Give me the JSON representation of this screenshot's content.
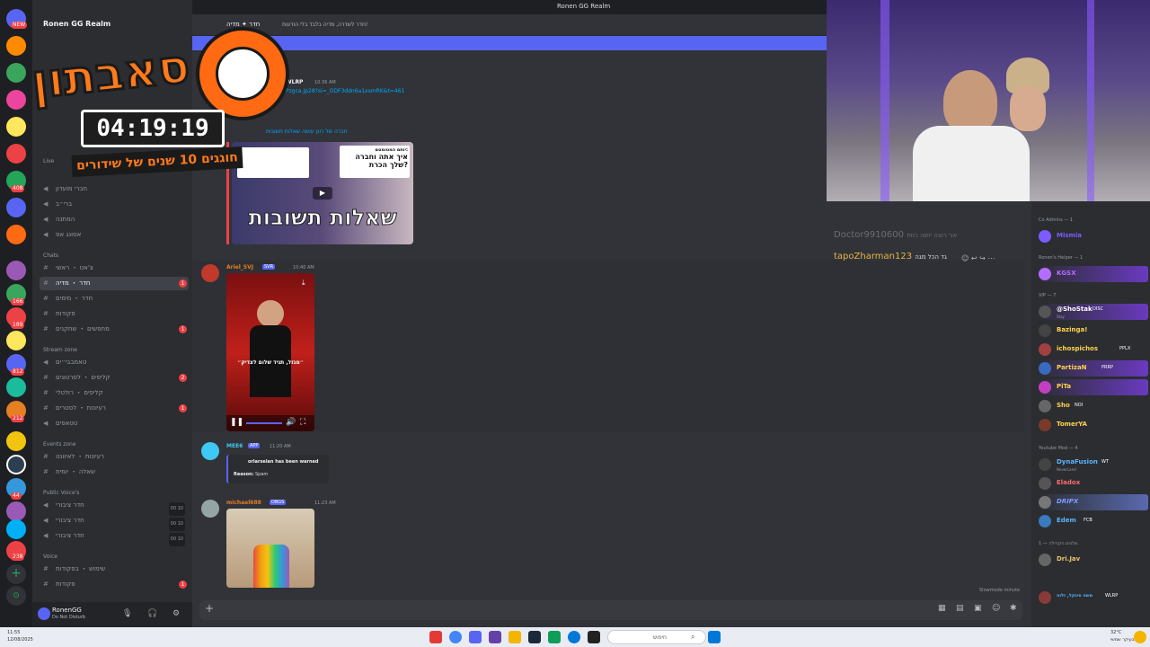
{
  "window": {
    "title": "Ronen GG Realm"
  },
  "server": {
    "name": "Ronen GG Realm",
    "badges": [
      "NEW",
      "101",
      "408",
      "166",
      "189",
      "812",
      "173",
      "212",
      "44",
      "238"
    ]
  },
  "channel_header": {
    "name": "חדר ✦ מדיה",
    "topic": "חדר לשדרה, מדיה בלבד בלי הודעות!"
  },
  "sidebar": {
    "categories": {
      "live": "Live",
      "chats": "Chats",
      "stream": "Stream zone",
      "events": "Events zone",
      "public_voice": "Public Voice's",
      "voice": "Voice"
    },
    "channels": [
      {
        "name": "חברי מועדון",
        "type": "voice"
      },
      {
        "name": "ברי״ב",
        "type": "voice"
      },
      {
        "name": "המתנה",
        "type": "voice"
      },
      {
        "name": "אסונג אס",
        "type": "voice"
      },
      {
        "name": "צ'אט ・ ראשי",
        "type": "text"
      },
      {
        "name": "חדר ・ מדיה",
        "type": "text",
        "active": true,
        "badge": "1"
      },
      {
        "name": "חדר ・ מימים",
        "type": "text"
      },
      {
        "name": "פקודות",
        "type": "text"
      },
      {
        "name": "מחפשים ・ שחקנים",
        "type": "text",
        "badge": "1"
      },
      {
        "name": "טאמבבי״ים",
        "type": "voice"
      },
      {
        "name": "קליפים ・ לסרטונים",
        "type": "text",
        "badge": "2"
      },
      {
        "name": "קליפים ・ רולטלי",
        "type": "text"
      },
      {
        "name": "רעיונות ・ לסטרים",
        "type": "text",
        "badge": "1"
      },
      {
        "name": "טטאפים",
        "type": "voice"
      },
      {
        "name": "רעיונות ・ לאיוונט",
        "type": "text"
      },
      {
        "name": "שאלה ・ יומית",
        "type": "text"
      },
      {
        "name": "חדר ציבורי",
        "type": "voice",
        "users": "00 10"
      },
      {
        "name": "חדר ציבורי",
        "type": "voice",
        "users": "00 10"
      },
      {
        "name": "חדר ציבורי",
        "type": "voice",
        "users": "00 10"
      },
      {
        "name": "שימוש ・ בפקודות",
        "type": "text"
      },
      {
        "name": "פקודות",
        "type": "text",
        "badge": "1"
      }
    ]
  },
  "user_panel": {
    "name": "RonenGG",
    "status": "Do Not Disturb"
  },
  "messages": {
    "first": {
      "author": "WLRP",
      "time": "10:36 AM",
      "link": "Pzgca.Jp28?si=_ODF3ddn6a1xsmRK&t=461",
      "embed_title": "חברה של רונן עושה שאלות תשובות",
      "thumb_text": "שאלות תשובות",
      "thumb_caption_1": "איך אתה וחברה",
      "thumb_caption_2": "שלך הכרת?",
      "thumb_caption_3": "יותם המטומטם:"
    },
    "second": {
      "author": "Ariel_SVJ",
      "tag": "SVR",
      "time": "10:40 AM",
      "video_caption": "״מגזל, תגיד שלום לצדיק״"
    },
    "third": {
      "author": "MEE6",
      "tag": "APP",
      "time": "11:20 AM",
      "warn_line": "orlarselan has been warned",
      "reason_label": "Reason:",
      "reason_value": "Spam"
    },
    "fourth": {
      "author": "michael688",
      "tag": "DBGS",
      "time": "11:23 AM"
    }
  },
  "composer": {
    "placeholder": ""
  },
  "slowmode": "Slowmode minute",
  "stream_chat": [
    {
      "user": "Doctor9910600",
      "text": "אני רוצה יושה כזות"
    },
    {
      "user": "tapoZharman123",
      "text": "גד הכל מגה"
    }
  ],
  "member_list": {
    "groups": [
      {
        "label": "Co Admins — 1",
        "members": [
          {
            "name": "Mismia",
            "color": "#7c5bff"
          }
        ]
      },
      {
        "label": "Ronen's Helper — 1",
        "members": [
          {
            "name": "KGSX",
            "color": "#b56dff"
          }
        ]
      },
      {
        "label": "VIP — 7",
        "members": [
          {
            "name": "@ShoStak",
            "color": "#ffffff",
            "tag": "DISC",
            "sub": "Stay"
          },
          {
            "name": "Bazinga!",
            "color": "#ffd34a"
          },
          {
            "name": "ichospichos",
            "color": "#ffd34a",
            "tag": "PPLX"
          },
          {
            "name": "PartizaN",
            "color": "#ffd34a",
            "tag": "PRRP"
          },
          {
            "name": "PiTa",
            "color": "#ffd34a"
          },
          {
            "name": "Sho",
            "color": "#ffd34a",
            "tag": "NOI"
          },
          {
            "name": "TomerYA",
            "color": "#ffd34a"
          }
        ]
      },
      {
        "label": "Youtube Mod — 4",
        "members": [
          {
            "name": "DynaFusion",
            "color": "#5ab4ff",
            "tag": "WT",
            "sub": "NeverLand"
          },
          {
            "name": "Eladox",
            "color": "#ff6b6b"
          },
          {
            "name": "DRIPX",
            "color": "#7c9bff"
          },
          {
            "name": "Edem",
            "color": "#5ab4ff",
            "tag": "FCB"
          }
        ]
      },
      {
        "label": "מלכים הקהילה — 1",
        "members": [
          {
            "name": "Dri.Jav",
            "color": "#e6c36b"
          }
        ]
      },
      {
        "label": "",
        "members": [
          {
            "name": "משה פינקל, זלוה",
            "color": "#e6c36b",
            "tag": "WLRP"
          }
        ]
      }
    ]
  },
  "overlay": {
    "title": "סאבתון",
    "time": "04:19:19",
    "subtitle": "חוגגים 10 שנים של שידורים"
  },
  "taskbar": {
    "time": "11:55",
    "date": "12/08/2025",
    "search_placeholder": "חיפוש",
    "weather": "32°C",
    "weather_desc": "בעיקר שמשי"
  }
}
